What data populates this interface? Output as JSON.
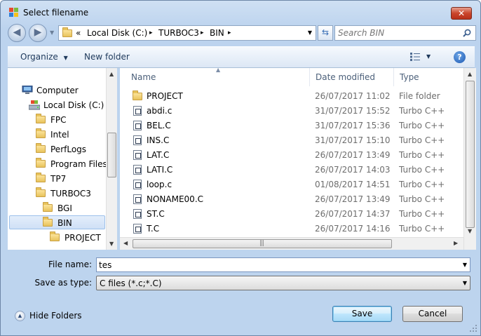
{
  "window": {
    "title": "Select filename"
  },
  "address": {
    "overflow": "«",
    "crumbs": [
      "Local Disk (C:)",
      "TURBOC3",
      "BIN"
    ],
    "separator": "▸"
  },
  "search": {
    "placeholder": "Search BIN",
    "value": ""
  },
  "toolbar": {
    "organize_label": "Organize",
    "new_folder_label": "New folder"
  },
  "nav": {
    "items": [
      {
        "label": "Computer",
        "kind": "computer"
      },
      {
        "label": "Local Disk (C:)",
        "kind": "disk"
      },
      {
        "label": "FPC",
        "kind": "folder"
      },
      {
        "label": "Intel",
        "kind": "folder"
      },
      {
        "label": "PerfLogs",
        "kind": "folder"
      },
      {
        "label": "Program Files",
        "kind": "folder"
      },
      {
        "label": "TP7",
        "kind": "folder"
      },
      {
        "label": "TURBOC3",
        "kind": "folder"
      },
      {
        "label": "BGI",
        "kind": "folder"
      },
      {
        "label": "BIN",
        "kind": "folder",
        "selected": true
      },
      {
        "label": "PROJECT",
        "kind": "folder"
      }
    ]
  },
  "columns": {
    "name": "Name",
    "date": "Date modified",
    "type": "Type"
  },
  "files": [
    {
      "name": "PROJECT",
      "date": "26/07/2017 11:02",
      "type": "File folder",
      "kind": "folder"
    },
    {
      "name": "abdi.c",
      "date": "31/07/2017 15:52",
      "type": "Turbo C++",
      "kind": "file"
    },
    {
      "name": "BEL.C",
      "date": "31/07/2017 15:36",
      "type": "Turbo C++",
      "kind": "file"
    },
    {
      "name": "INS.C",
      "date": "31/07/2017 15:10",
      "type": "Turbo C++",
      "kind": "file"
    },
    {
      "name": "LAT.C",
      "date": "26/07/2017 13:49",
      "type": "Turbo C++",
      "kind": "file"
    },
    {
      "name": "LATI.C",
      "date": "26/07/2017 14:03",
      "type": "Turbo C++",
      "kind": "file"
    },
    {
      "name": "loop.c",
      "date": "01/08/2017 14:51",
      "type": "Turbo C++",
      "kind": "file"
    },
    {
      "name": "NONAME00.C",
      "date": "26/07/2017 13:49",
      "type": "Turbo C++",
      "kind": "file"
    },
    {
      "name": "ST.C",
      "date": "26/07/2017 14:37",
      "type": "Turbo C++",
      "kind": "file"
    },
    {
      "name": "T.C",
      "date": "26/07/2017 14:16",
      "type": "Turbo C++",
      "kind": "file"
    }
  ],
  "form": {
    "filename_label": "File name:",
    "filename_value": "tes",
    "filetype_label": "Save as type:",
    "filetype_value": "C files (*.c;*.C)"
  },
  "footer": {
    "hide_folders_label": "Hide Folders",
    "save_label": "Save",
    "cancel_label": "Cancel"
  },
  "colors": {
    "accent": "#3c7fb1",
    "close": "#c9452b",
    "folder": "#e8c35b",
    "chrome": "#bcd3ee"
  }
}
